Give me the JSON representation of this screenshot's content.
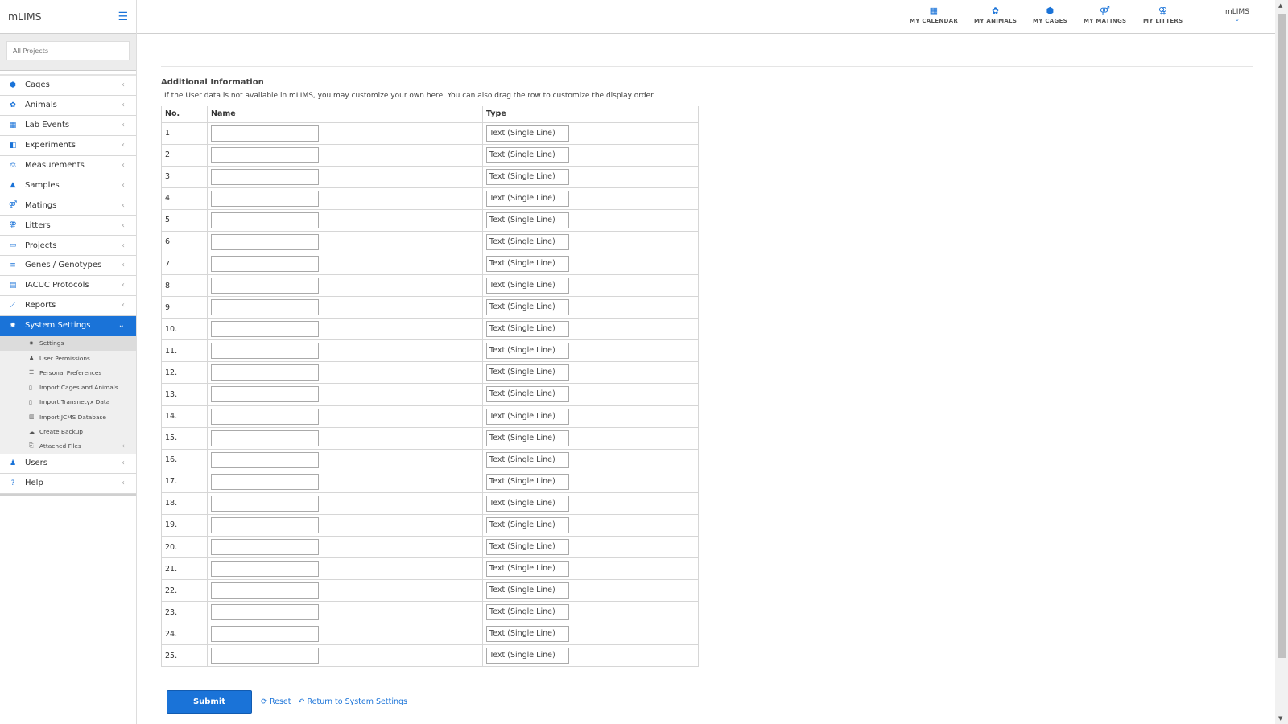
{
  "app": {
    "name": "mLIMS"
  },
  "project_selector": {
    "placeholder": "All Projects"
  },
  "sidebar": {
    "items": [
      {
        "label": "Cages",
        "icon": "cube-icon",
        "glyph": "⬢"
      },
      {
        "label": "Animals",
        "icon": "paw-icon",
        "glyph": "✿"
      },
      {
        "label": "Lab Events",
        "icon": "calendar-icon",
        "glyph": "▦"
      },
      {
        "label": "Experiments",
        "icon": "flask-icon",
        "glyph": "◧"
      },
      {
        "label": "Measurements",
        "icon": "scale-icon",
        "glyph": "⚖"
      },
      {
        "label": "Samples",
        "icon": "beaker-icon",
        "glyph": "▲"
      },
      {
        "label": "Matings",
        "icon": "mating-icon",
        "glyph": "⚤"
      },
      {
        "label": "Litters",
        "icon": "litter-icon",
        "glyph": "⚢"
      },
      {
        "label": "Projects",
        "icon": "folder-icon",
        "glyph": "▭"
      },
      {
        "label": "Genes / Genotypes",
        "icon": "list-icon",
        "glyph": "≡"
      },
      {
        "label": "IACUC Protocols",
        "icon": "book-icon",
        "glyph": "▤"
      },
      {
        "label": "Reports",
        "icon": "chart-icon",
        "glyph": "⟋"
      }
    ],
    "active": {
      "label": "System Settings",
      "icon": "gear-icon",
      "glyph": "✹"
    },
    "subitems": [
      {
        "label": "Settings",
        "icon": "gear-icon",
        "glyph": "✹"
      },
      {
        "label": "User Permissions",
        "icon": "users-icon",
        "glyph": "♟"
      },
      {
        "label": "Personal Preferences",
        "icon": "sliders-icon",
        "glyph": "☰"
      },
      {
        "label": "Import Cages and Animals",
        "icon": "file-icon",
        "glyph": "▯"
      },
      {
        "label": "Import Transnetyx Data",
        "icon": "file-icon",
        "glyph": "▯"
      },
      {
        "label": "Import JCMS Database",
        "icon": "database-icon",
        "glyph": "▥"
      },
      {
        "label": "Create Backup",
        "icon": "cloud-icon",
        "glyph": "☁"
      },
      {
        "label": "Attached Files",
        "icon": "attachment-icon",
        "glyph": "⎘"
      }
    ],
    "bottom": [
      {
        "label": "Users",
        "icon": "users-icon",
        "glyph": "♟"
      },
      {
        "label": "Help",
        "icon": "question-icon",
        "glyph": "?"
      }
    ]
  },
  "topnav": {
    "items": [
      {
        "label": "MY CALENDAR",
        "icon": "calendar-icon",
        "glyph": "▦"
      },
      {
        "label": "MY ANIMALS",
        "icon": "paw-icon",
        "glyph": "✿"
      },
      {
        "label": "MY CAGES",
        "icon": "cube-icon",
        "glyph": "⬢"
      },
      {
        "label": "MY MATINGS",
        "icon": "mating-icon",
        "glyph": "⚤"
      },
      {
        "label": "MY LITTERS",
        "icon": "litter-icon",
        "glyph": "⚢"
      }
    ],
    "user": "mLIMS"
  },
  "main": {
    "title": "Additional Information",
    "description": "If the User data is not available in mLIMS, you may customize your own here. You can also drag the row to customize the display order.",
    "columns": [
      "No.",
      "Name",
      "Type"
    ],
    "rows": [
      {
        "no": "1.",
        "name": "",
        "type": "Text (Single Line)"
      },
      {
        "no": "2.",
        "name": "",
        "type": "Text (Single Line)"
      },
      {
        "no": "3.",
        "name": "",
        "type": "Text (Single Line)"
      },
      {
        "no": "4.",
        "name": "",
        "type": "Text (Single Line)"
      },
      {
        "no": "5.",
        "name": "",
        "type": "Text (Single Line)"
      },
      {
        "no": "6.",
        "name": "",
        "type": "Text (Single Line)"
      },
      {
        "no": "7.",
        "name": "",
        "type": "Text (Single Line)"
      },
      {
        "no": "8.",
        "name": "",
        "type": "Text (Single Line)"
      },
      {
        "no": "9.",
        "name": "",
        "type": "Text (Single Line)"
      },
      {
        "no": "10.",
        "name": "",
        "type": "Text (Single Line)"
      },
      {
        "no": "11.",
        "name": "",
        "type": "Text (Single Line)"
      },
      {
        "no": "12.",
        "name": "",
        "type": "Text (Single Line)"
      },
      {
        "no": "13.",
        "name": "",
        "type": "Text (Single Line)"
      },
      {
        "no": "14.",
        "name": "",
        "type": "Text (Single Line)"
      },
      {
        "no": "15.",
        "name": "",
        "type": "Text (Single Line)"
      },
      {
        "no": "16.",
        "name": "",
        "type": "Text (Single Line)"
      },
      {
        "no": "17.",
        "name": "",
        "type": "Text (Single Line)"
      },
      {
        "no": "18.",
        "name": "",
        "type": "Text (Single Line)"
      },
      {
        "no": "19.",
        "name": "",
        "type": "Text (Single Line)"
      },
      {
        "no": "20.",
        "name": "",
        "type": "Text (Single Line)"
      },
      {
        "no": "21.",
        "name": "",
        "type": "Text (Single Line)"
      },
      {
        "no": "22.",
        "name": "",
        "type": "Text (Single Line)"
      },
      {
        "no": "23.",
        "name": "",
        "type": "Text (Single Line)"
      },
      {
        "no": "24.",
        "name": "",
        "type": "Text (Single Line)"
      },
      {
        "no": "25.",
        "name": "",
        "type": "Text (Single Line)"
      }
    ],
    "submit_label": "Submit",
    "reset_label": "Reset",
    "return_label": "Return to System Settings"
  },
  "colors": {
    "accent": "#1a73d8",
    "border": "#d6d6d6",
    "submenu_bg": "#efefef"
  }
}
